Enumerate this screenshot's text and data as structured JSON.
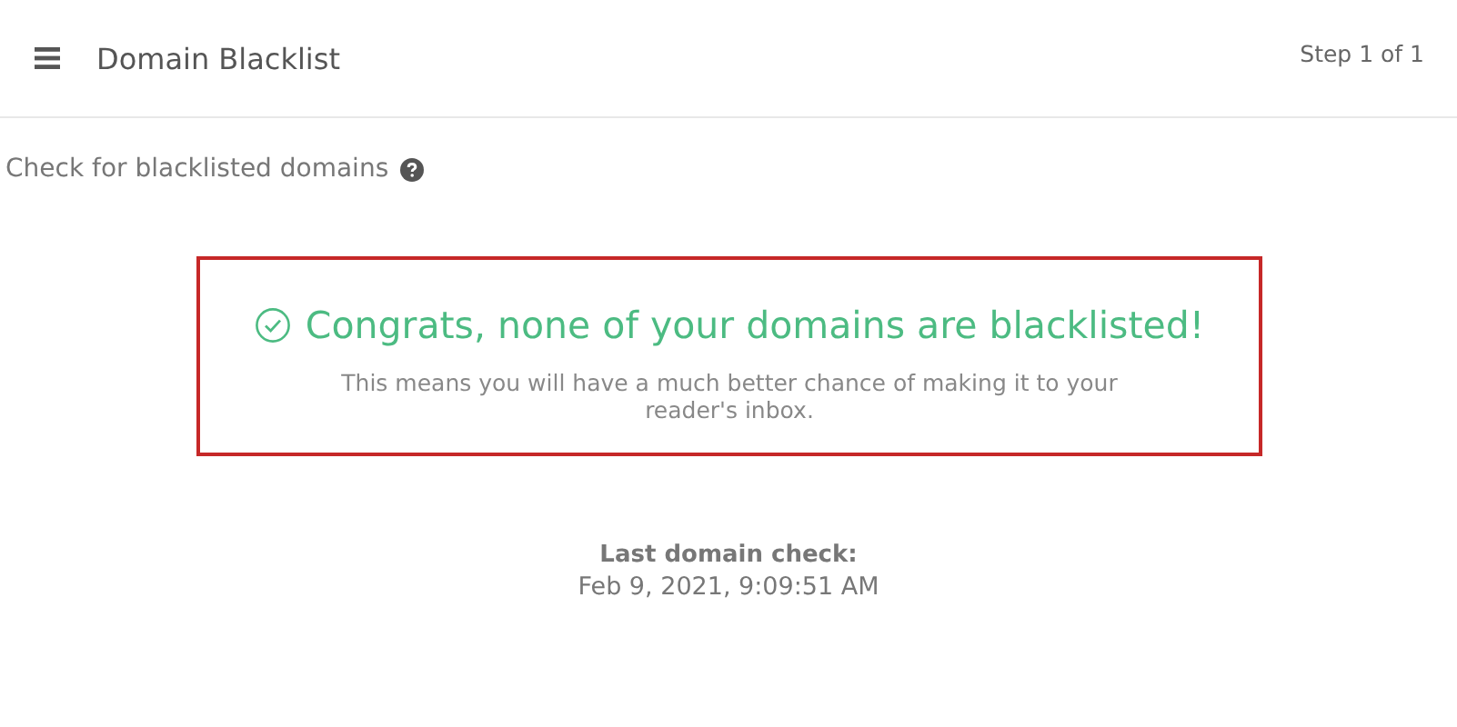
{
  "header": {
    "title": "Domain Blacklist",
    "step": "Step 1 of 1"
  },
  "section": {
    "label": "Check for blacklisted domains"
  },
  "result": {
    "success": true,
    "headline": "Congrats, none of your domains are blacklisted!",
    "message": "This means you will have a much better chance of making it to your reader's inbox."
  },
  "last_check": {
    "label": "Last domain check:",
    "value": "Feb 9, 2021, 9:09:51 AM"
  }
}
